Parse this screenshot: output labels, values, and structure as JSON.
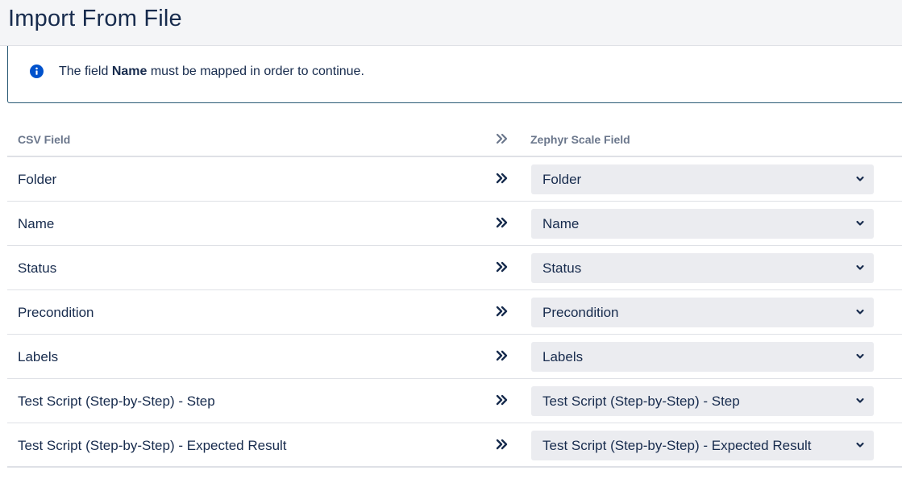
{
  "page": {
    "title": "Import From File"
  },
  "info": {
    "prefix": "The field ",
    "field": "Name",
    "suffix": " must be mapped in order to continue."
  },
  "table": {
    "headers": {
      "csv": "CSV Field",
      "zephyr": "Zephyr Scale Field"
    },
    "rows": [
      {
        "csv": "Folder",
        "zephyr": "Folder"
      },
      {
        "csv": "Name",
        "zephyr": "Name"
      },
      {
        "csv": "Status",
        "zephyr": "Status"
      },
      {
        "csv": "Precondition",
        "zephyr": "Precondition"
      },
      {
        "csv": "Labels",
        "zephyr": "Labels"
      },
      {
        "csv": "Test Script (Step-by-Step) - Step",
        "zephyr": "Test Script (Step-by-Step) - Step"
      },
      {
        "csv": "Test Script (Step-by-Step) - Expected Result",
        "zephyr": "Test Script (Step-by-Step) - Expected Result"
      }
    ]
  },
  "colors": {
    "info_icon": "#0052cc",
    "header_bg": "#f4f5f7",
    "select_bg": "#ebecf0",
    "text": "#172b4d",
    "muted": "#6b778c"
  },
  "icons": {
    "info": "info-icon",
    "arrows": "double-chevron-right-icon",
    "dropdown": "chevron-down-icon"
  }
}
